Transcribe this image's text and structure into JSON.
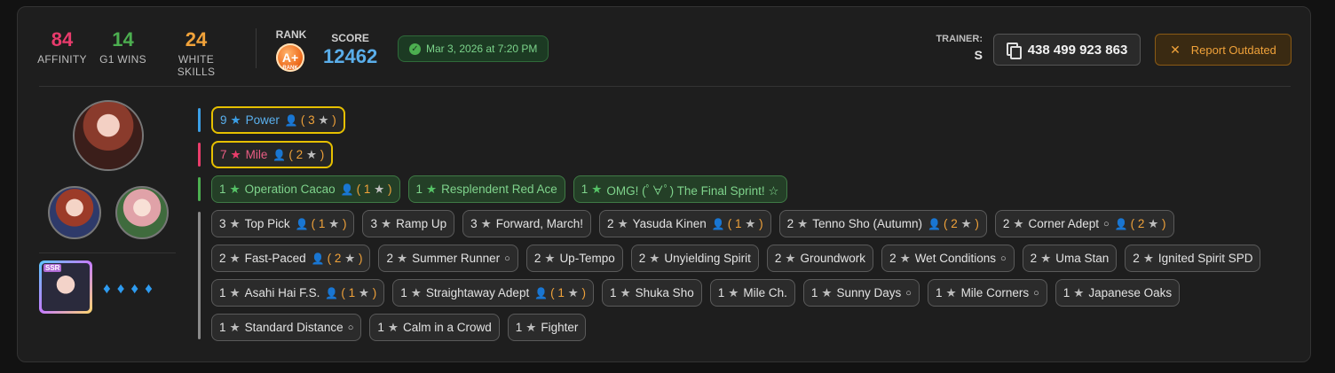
{
  "header": {
    "stats": [
      {
        "value": "84",
        "label": "AFFINITY",
        "color": "#e83b6c"
      },
      {
        "value": "14",
        "label": "G1 WINS",
        "color": "#4caf50"
      },
      {
        "value": "24",
        "label": "WHITE SKILLS",
        "color": "#f0a23a"
      }
    ],
    "rank": {
      "label": "RANK",
      "badge": "A+",
      "badge_sub": "RANK"
    },
    "score": {
      "label": "SCORE",
      "value": "12462"
    },
    "date": "Mar 3, 2026 at 7:20 PM",
    "trainer": {
      "label": "TRAINER:",
      "name": "S"
    },
    "trainer_id": "438 499 923 863",
    "report_label": "Report Outdated"
  },
  "left": {
    "diamonds": [
      "♦",
      "♦",
      "♦",
      "♦"
    ],
    "support_tag": "SSR"
  },
  "rows": [
    {
      "bar": "#3b9fe6",
      "chips": [
        {
          "style": "blue",
          "count": "1",
          "stars": "9",
          "name": "Power",
          "parent": "3"
        }
      ]
    },
    {
      "bar": "#ea3d6b",
      "chips": [
        {
          "style": "pink",
          "stars": "7",
          "name": "Mile",
          "parent": "2"
        }
      ]
    },
    {
      "bar": "#4caf50",
      "chips": [
        {
          "style": "green",
          "stars": "1",
          "name": "Operation Cacao",
          "parent": "1"
        },
        {
          "style": "green",
          "stars": "1",
          "name": "Resplendent Red Ace"
        },
        {
          "style": "green",
          "stars": "1",
          "name": "OMG! (ﾟ∀ﾟ) The Final Sprint! ☆"
        }
      ]
    },
    {
      "bar": "#8a8a8a",
      "chips": [
        {
          "style": "white",
          "stars": "3",
          "name": "Top Pick",
          "parent": "1"
        },
        {
          "style": "white",
          "stars": "3",
          "name": "Ramp Up"
        },
        {
          "style": "white",
          "stars": "3",
          "name": "Forward, March!"
        },
        {
          "style": "white",
          "stars": "2",
          "name": "Yasuda Kinen",
          "parent": "1"
        },
        {
          "style": "white",
          "stars": "2",
          "name": "Tenno Sho (Autumn)",
          "parent": "2"
        },
        {
          "style": "white",
          "stars": "2",
          "name": "Corner Adept",
          "circle": true,
          "parent": "2"
        },
        {
          "style": "white",
          "stars": "2",
          "name": "Fast-Paced",
          "parent": "2"
        },
        {
          "style": "white",
          "stars": "2",
          "name": "Summer Runner",
          "circle": true
        },
        {
          "style": "white",
          "stars": "2",
          "name": "Up-Tempo"
        },
        {
          "style": "white",
          "stars": "2",
          "name": "Unyielding Spirit"
        },
        {
          "style": "white",
          "stars": "2",
          "name": "Groundwork"
        },
        {
          "style": "white",
          "stars": "2",
          "name": "Wet Conditions",
          "circle": true
        },
        {
          "style": "white",
          "stars": "2",
          "name": "Uma Stan"
        },
        {
          "style": "white",
          "stars": "2",
          "name": "Ignited Spirit SPD"
        },
        {
          "style": "white",
          "stars": "1",
          "name": "Asahi Hai F.S.",
          "parent": "1"
        },
        {
          "style": "white",
          "stars": "1",
          "name": "Straightaway Adept",
          "parent": "1"
        },
        {
          "style": "white",
          "stars": "1",
          "name": "Shuka Sho"
        },
        {
          "style": "white",
          "stars": "1",
          "name": "Mile Ch."
        },
        {
          "style": "white",
          "stars": "1",
          "name": "Sunny Days",
          "circle": true
        },
        {
          "style": "white",
          "stars": "1",
          "name": "Mile Corners",
          "circle": true
        },
        {
          "style": "white",
          "stars": "1",
          "name": "Japanese Oaks"
        },
        {
          "style": "white",
          "stars": "1",
          "name": "Standard Distance",
          "circle": true
        },
        {
          "style": "white",
          "stars": "1",
          "name": "Calm in a Crowd"
        },
        {
          "style": "white",
          "stars": "1",
          "name": "Fighter"
        }
      ]
    }
  ]
}
